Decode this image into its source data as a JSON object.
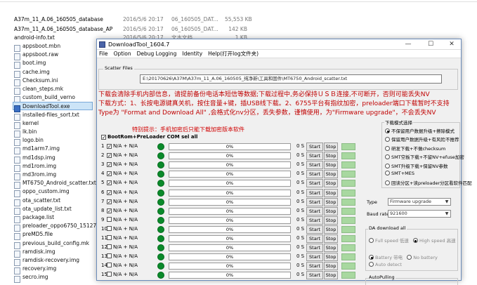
{
  "explorer": {
    "top_rows": [
      {
        "name": "A37m_11_A.06_160505_database",
        "date": "2016/5/6 20:17",
        "type": "06_160505_DAT...",
        "size": "55,553 KB"
      },
      {
        "name": "A37m_11_A.06_160505_database_AP",
        "date": "2016/5/6 20:17",
        "type": "06_160505_DAT...",
        "size": "142 KB"
      },
      {
        "name": "android-info.txt",
        "date": "2016/5/6 20:17",
        "type": "文本文档",
        "size": "1 KB"
      }
    ],
    "files": [
      "appsboot.mbn",
      "appsboot.raw",
      "boot.img",
      "cache.img",
      "Checksum.ini",
      "clean_steps.mk",
      "custom_build_verno",
      "DownloadTool.exe",
      "installed-files_sort.txt",
      "kernel",
      "lk.bin",
      "logo.bin",
      "md1arm7.img",
      "md1dsp.img",
      "md1rom.img",
      "md3rom.img",
      "MT6750_Android_scatter.txt",
      "oppo_custom.img",
      "ota_scatter.txt",
      "ota_update_list.txt",
      "package.list",
      "preloader_oppo6750_15127.bin",
      "preMD5.file",
      "previous_build_config.mk",
      "ramdisk.img",
      "ramdisk-recovery.img",
      "recovery.img",
      "secro.img"
    ]
  },
  "window": {
    "title": "DownloadTool_1604.7",
    "controls": [
      "—",
      "☐",
      "✕"
    ],
    "menu": [
      "File",
      "Option",
      "Debug Logging",
      "Identity",
      "Help(打开log文件夹)"
    ]
  },
  "scatter": {
    "label": "Scatter Files",
    "path": "E:\\20170626\\A37M\\A37m_11_A.06_160505_纯净新\\工具和固件\\MT6750_Android_scatter.txt"
  },
  "warning_lines": [
    "下载会清除手机内部信息，请提前备份电话本短信等数据;下载过程中,务必保持ＵＳＢ连接,不可断开，否则可能丢失NV",
    "下载方式：1、长按电源键真关机，按住音量+键，插USB线下载。2、6755平台有指纹加密，preloader端口下载暂时不支持",
    "Type为 \"Format and Download All\" ,会格式化nv分区，丢失参数，谨慎使用，为\"Firmware upgrade\"，不会丢失NV"
  ],
  "hint": "特别提示：手机加密后只能下载加密版本软件",
  "bootrom_label": "BootRom+PreLoader COM sel all",
  "rows": [
    {
      "idx": "1",
      "checked": true,
      "na": "N/A + N/A",
      "progress": "0%",
      "sec": "0 S",
      "start": "Start",
      "stop": "Stop"
    },
    {
      "idx": "2",
      "checked": true,
      "na": "N/A + N/A",
      "progress": "0%",
      "sec": "0 S",
      "start": "Start",
      "stop": "Stop"
    },
    {
      "idx": "3",
      "checked": true,
      "na": "N/A + N/A",
      "progress": "0%",
      "sec": "0 S",
      "start": "Start",
      "stop": "Stop"
    },
    {
      "idx": "4",
      "checked": true,
      "na": "N/A + N/A",
      "progress": "0%",
      "sec": "0 S",
      "start": "Start",
      "stop": "Stop"
    },
    {
      "idx": "5",
      "checked": true,
      "na": "N/A + N/A",
      "progress": "0%",
      "sec": "0 S",
      "start": "Start",
      "stop": "Stop"
    },
    {
      "idx": "6",
      "checked": true,
      "na": "N/A + N/A",
      "progress": "0%",
      "sec": "0 S",
      "start": "Start",
      "stop": "Stop"
    },
    {
      "idx": "7",
      "checked": true,
      "na": "N/A + N/A",
      "progress": "0%",
      "sec": "0 S",
      "start": "Start",
      "stop": "Stop"
    },
    {
      "idx": "8",
      "checked": true,
      "na": "N/A + N/A",
      "progress": "0%",
      "sec": "0 S",
      "start": "Start",
      "stop": "Stop"
    },
    {
      "idx": "9",
      "checked": false,
      "na": "N/A + N/A",
      "progress": "0%",
      "sec": "0 S",
      "start": "Start",
      "stop": "Stop"
    },
    {
      "idx": "10",
      "checked": false,
      "na": "N/A + N/A",
      "progress": "0%",
      "sec": "0 S",
      "start": "Start",
      "stop": "Stop"
    },
    {
      "idx": "11",
      "checked": false,
      "na": "N/A + N/A",
      "progress": "0%",
      "sec": "0 S",
      "start": "Start",
      "stop": "Stop"
    },
    {
      "idx": "12",
      "checked": false,
      "na": "N/A + N/A",
      "progress": "0%",
      "sec": "0 S",
      "start": "Start",
      "stop": "Stop"
    },
    {
      "idx": "13",
      "checked": false,
      "na": "N/A + N/A",
      "progress": "0%",
      "sec": "0 S",
      "start": "Start",
      "stop": "Stop"
    },
    {
      "idx": "14",
      "checked": false,
      "na": "N/A + N/A",
      "progress": "0%",
      "sec": "0 S",
      "start": "Start",
      "stop": "Stop"
    },
    {
      "idx": "15",
      "checked": false,
      "na": "N/A + N/A",
      "progress": "0%",
      "sec": "0 S",
      "start": "Start",
      "stop": "Stop"
    }
  ],
  "download_mode": {
    "label": "下载模式选择",
    "options": [
      {
        "text": "不保留用户数据升级+擦除模式",
        "on": true
      },
      {
        "text": "保留用户数据升级+有风险不推荐",
        "on": false
      },
      {
        "text": "研发下载+不做checksum",
        "on": false
      },
      {
        "text": "SMT空板下载+不留NV+efuse加密",
        "on": false
      },
      {
        "text": "SMT升级下载+保留NV参数",
        "on": false
      },
      {
        "text": "SMT+MES",
        "on": false
      },
      {
        "text": "回读分区+读preloader分区看软件匹配",
        "on": false
      }
    ]
  },
  "type_select": {
    "label": "Type",
    "value": "Firmware upgrade"
  },
  "baud_select": {
    "label": "Baud rate",
    "value": "921600"
  },
  "da_download": {
    "label": "DA download all",
    "speed_options": [
      "Full speed 低速",
      "High speed 高速"
    ],
    "battery_options": [
      "Battery 带电",
      "No battery"
    ],
    "auto_detect": "Auto detect"
  },
  "auto_pulling": {
    "label": "AutoPulling"
  }
}
